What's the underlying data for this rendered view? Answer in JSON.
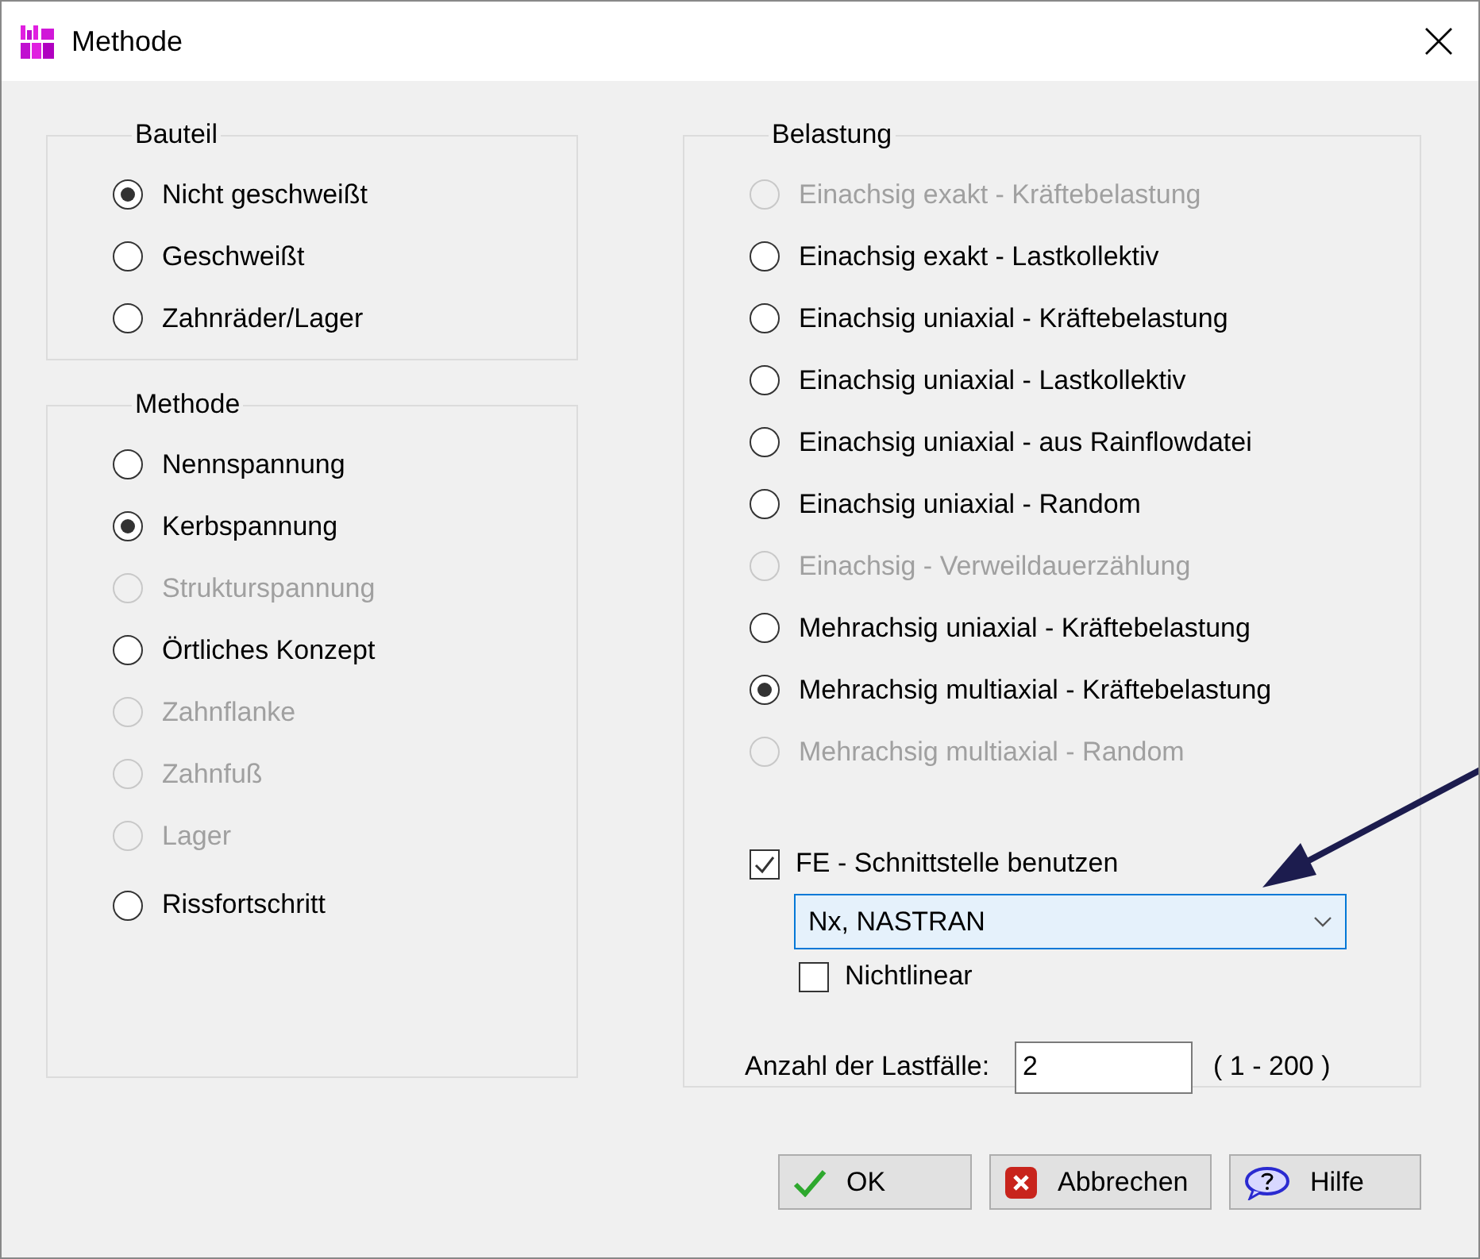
{
  "window": {
    "title": "Methode"
  },
  "bauteil": {
    "title": "Bauteil",
    "options": [
      {
        "label": "Nicht geschweißt",
        "selected": true,
        "disabled": false
      },
      {
        "label": "Geschweißt",
        "selected": false,
        "disabled": false
      },
      {
        "label": "Zahnräder/Lager",
        "selected": false,
        "disabled": false
      }
    ]
  },
  "methode": {
    "title": "Methode",
    "options": [
      {
        "label": "Nennspannung",
        "selected": false,
        "disabled": false
      },
      {
        "label": "Kerbspannung",
        "selected": true,
        "disabled": false
      },
      {
        "label": "Strukturspannung",
        "selected": false,
        "disabled": true
      },
      {
        "label": "Örtliches Konzept",
        "selected": false,
        "disabled": false
      },
      {
        "label": "Zahnflanke",
        "selected": false,
        "disabled": true
      },
      {
        "label": "Zahnfuß",
        "selected": false,
        "disabled": true
      },
      {
        "label": "Lager",
        "selected": false,
        "disabled": true
      },
      {
        "label": "Rissfortschritt",
        "selected": false,
        "disabled": false
      }
    ]
  },
  "belastung": {
    "title": "Belastung",
    "options": [
      {
        "label": "Einachsig exakt - Kräftebelastung",
        "selected": false,
        "disabled": true
      },
      {
        "label": "Einachsig exakt - Lastkollektiv",
        "selected": false,
        "disabled": false
      },
      {
        "label": "Einachsig uniaxial - Kräftebelastung",
        "selected": false,
        "disabled": false
      },
      {
        "label": "Einachsig uniaxial - Lastkollektiv",
        "selected": false,
        "disabled": false
      },
      {
        "label": "Einachsig uniaxial - aus Rainflowdatei",
        "selected": false,
        "disabled": false
      },
      {
        "label": "Einachsig uniaxial - Random",
        "selected": false,
        "disabled": false
      },
      {
        "label": "Einachsig - Verweildauerzählung",
        "selected": false,
        "disabled": true
      },
      {
        "label": "Mehrachsig uniaxial - Kräftebelastung",
        "selected": false,
        "disabled": false
      },
      {
        "label": "Mehrachsig multiaxial - Kräftebelastung",
        "selected": true,
        "disabled": false
      },
      {
        "label": "Mehrachsig multiaxial - Random",
        "selected": false,
        "disabled": true
      }
    ],
    "fe_interface": {
      "label": "FE - Schnittstelle benutzen",
      "checked": true
    },
    "fe_program": {
      "value": "Nx, NASTRAN"
    },
    "nonlinear": {
      "label": "Nichtlinear",
      "checked": false
    },
    "load_cases": {
      "label": "Anzahl der Lastfälle:",
      "value": "2",
      "range": "( 1 - 200 )"
    }
  },
  "buttons": [
    {
      "label": "OK",
      "kind": "ok"
    },
    {
      "label": "Abbrechen",
      "kind": "cancel"
    },
    {
      "label": "Hilfe",
      "kind": "help"
    }
  ]
}
